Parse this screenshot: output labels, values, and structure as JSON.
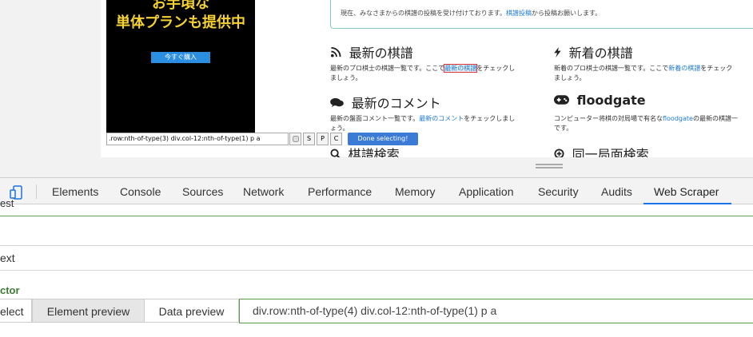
{
  "webpage": {
    "ad": {
      "line1": "お手頃な",
      "line2": "単体プランも提供中",
      "button": "今すぐ購入"
    },
    "notice": {
      "text_before": "現在、みなさまからの棋譜の投稿を受け付けております。",
      "link": "棋譜投稿",
      "text_after": "から投稿お願いします。"
    },
    "sections": {
      "latest_kifu": {
        "icon": "rss-icon",
        "title": "最新の棋譜",
        "desc_before": "最新のプロ棋士の棋譜一覧です。ここで",
        "link": "最新の棋譜",
        "desc_after": "をチェックし",
        "desc_line2": "ましょう。"
      },
      "new_kifu": {
        "icon": "bolt-icon",
        "title": "新着の棋譜",
        "desc_before": "新着のプロ棋士の棋譜一覧です。ここで",
        "link": "新着の棋譜",
        "desc_after": "をチェック",
        "desc_line2": "ましょう。"
      },
      "latest_comments": {
        "icon": "comments-icon",
        "title": "最新のコメント",
        "desc_before": "最新の盤面コメント一覧です。",
        "link": "最新のコメント",
        "desc_after": "をチェックしまし",
        "desc_line2": "ょう。"
      },
      "floodgate": {
        "icon": "gamepad-icon",
        "title": "floodgate",
        "desc_before": "コンピューター将棋の対局場で有名な",
        "link": "floodgate",
        "desc_after": "の最新の棋譜一",
        "desc_line2": "です。"
      },
      "kifu_search": {
        "icon": "search-icon",
        "title": "棋譜検索"
      },
      "same_position": {
        "icon": "plus-circle-icon",
        "title": "同一局面検索"
      }
    },
    "selector_bar": {
      "path": ".row:nth-of-type(3) div.col-12:nth-of-type(1) p a",
      "buttons": [
        "S",
        "P",
        "C"
      ],
      "done": "Done selecting!"
    }
  },
  "devtools": {
    "tabs": [
      "Elements",
      "Console",
      "Sources",
      "Network",
      "Performance",
      "Memory",
      "Application",
      "Security",
      "Audits",
      "Web Scraper"
    ],
    "active_tab": "Web Scraper",
    "form": {
      "row1_label": "est",
      "row2_label": "",
      "row3_label": "ext",
      "selector_label": "ctor",
      "selector_tabs": [
        "elect",
        "Element preview",
        "Data preview"
      ],
      "selector_value": "div.row:nth-of-type(4) div.col-12:nth-of-type(1) p a"
    }
  }
}
